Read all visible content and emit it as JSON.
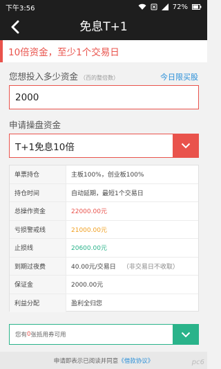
{
  "statusbar": {
    "time": "下午3:56",
    "battery": "72%"
  },
  "navbar": {
    "title": "免息T+1"
  },
  "banner": {
    "text": "10倍资金，至少1个交易日"
  },
  "invest": {
    "label": "您想投入多少资金",
    "hint": "（百的整倍数）",
    "link": "今日限买股",
    "value": "2000"
  },
  "apply": {
    "label": "申请操盘资金",
    "selected": "T+1免息10倍"
  },
  "table": {
    "rows": [
      {
        "key": "单票持仓",
        "value": "主板100%，创业板100%",
        "note": ""
      },
      {
        "key": "持仓时间",
        "value": "自动延期，最短1个交易日",
        "note": ""
      },
      {
        "key": "总操作资金",
        "value": "22000.00元",
        "note": ""
      },
      {
        "key": "亏损警戒线",
        "value": "21000.00元",
        "note": ""
      },
      {
        "key": "止损线",
        "value": "20600.00元",
        "note": ""
      },
      {
        "key": "到期过夜费",
        "value": "40.00元/交易日",
        "note": "（非交易日不收取）"
      },
      {
        "key": "保证金",
        "value": "2000.00元",
        "note": ""
      },
      {
        "key": "利益分配",
        "value": "盈利全归您",
        "note": ""
      }
    ]
  },
  "coupon": {
    "prefix": "您有",
    "count": "0",
    "suffix": "张抵用券可用"
  },
  "footer": {
    "text": "申请即表示已阅读并同意",
    "link": "《借款协议》"
  },
  "watermark": "pc6"
}
